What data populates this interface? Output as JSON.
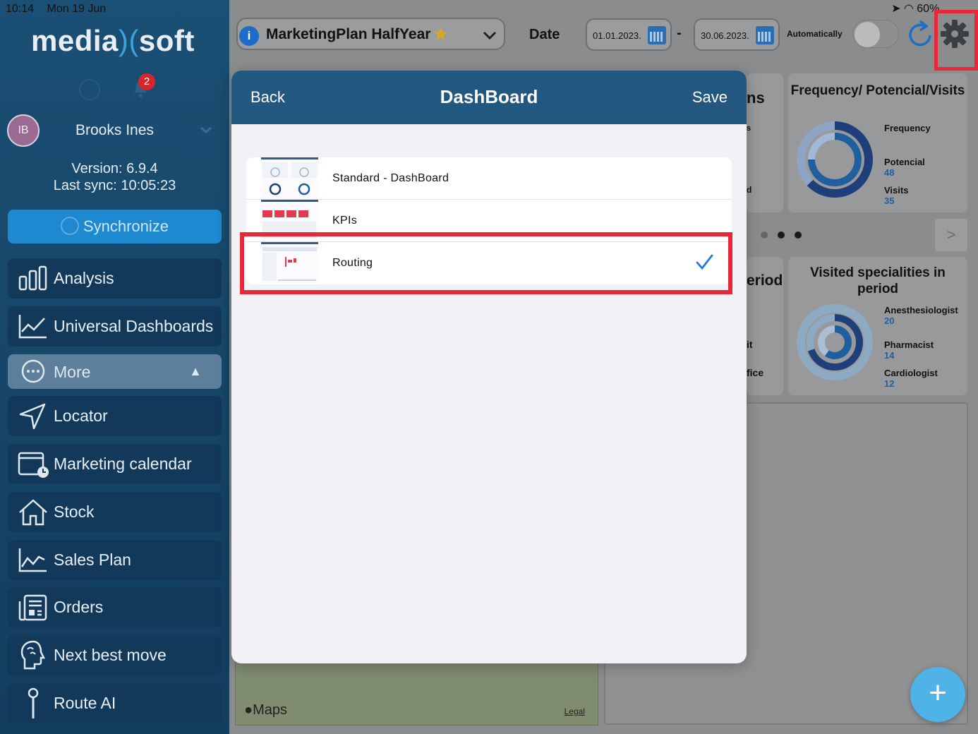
{
  "status": {
    "time": "10:14",
    "date": "Mon 19 Jun",
    "battery": "60%"
  },
  "app": {
    "logo_left": "media",
    "logo_right": "soft"
  },
  "notifications": {
    "count": "2"
  },
  "user": {
    "initials": "IB",
    "name": "Brooks Ines"
  },
  "version": {
    "version_line": "Version: 6.9.4",
    "sync_line": "Last sync: 10:05:23"
  },
  "sync_button": "Synchronize",
  "nav": [
    {
      "label": "Analysis",
      "icon": "bar-chart-icon"
    },
    {
      "label": "Universal Dashboards",
      "icon": "line-chart-icon"
    },
    {
      "label": "More",
      "icon": "more-dots-icon"
    },
    {
      "label": "Locator",
      "icon": "navigation-arrow-icon"
    },
    {
      "label": "Marketing calendar",
      "icon": "calendar-clock-icon"
    },
    {
      "label": "Stock",
      "icon": "home-icon"
    },
    {
      "label": "Sales Plan",
      "icon": "trend-chart-icon"
    },
    {
      "label": "Orders",
      "icon": "document-list-icon"
    },
    {
      "label": "Next best move",
      "icon": "brain-head-icon"
    },
    {
      "label": "Route AI",
      "icon": "map-pin-icon"
    }
  ],
  "topbar": {
    "plan": "MarketingPlan HalfYear",
    "date_label": "Date",
    "date_from": "01.01.2023.",
    "date_to": "30.06.2023.",
    "dash": "-",
    "auto_label": "Automatically"
  },
  "cards": {
    "freq_title": "Frequency/ Potencial/Visits",
    "freq_items": [
      {
        "label": "Frequency",
        "value": ""
      },
      {
        "label": "Potencial",
        "value": "48"
      },
      {
        "label": "Visits",
        "value": "35"
      }
    ],
    "spec_title": "Visited specialities in period",
    "spec_items": [
      {
        "label": "Anesthesiologist",
        "value": "20"
      },
      {
        "label": "Pharmacist",
        "value": "14"
      },
      {
        "label": "Cardiologist",
        "value": "12"
      }
    ],
    "partial_ns": "ns",
    "partial_s": "s",
    "partial_d": "d",
    "partial_riod": "eriod",
    "partial_it": "it",
    "partial_fice": "fice",
    "next": ">"
  },
  "map": {
    "label": "Maps",
    "legal": "Legal"
  },
  "fab": "+",
  "modal": {
    "back": "Back",
    "title": "DashBoard",
    "save": "Save",
    "options": [
      {
        "label": "Standard - DashBoard",
        "selected": false
      },
      {
        "label": "KPIs",
        "selected": false
      },
      {
        "label": "Routing",
        "selected": true
      }
    ]
  },
  "colors": {
    "accent": "#1e88d0",
    "highlight": "#e8283a",
    "header": "#225780",
    "sidebar": "#17486b"
  }
}
